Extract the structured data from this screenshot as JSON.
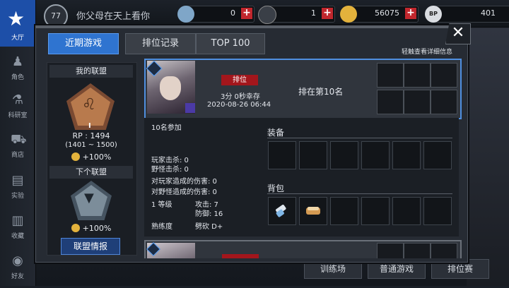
{
  "hud": {
    "level": "77",
    "username": "你父母在天上看你",
    "resource1": "0",
    "resource2": "1",
    "gold": "56075",
    "bp": "401",
    "bp_label": "BP"
  },
  "leftnav": {
    "top_label": "大厅",
    "items": [
      "角色",
      "科研室",
      "商店",
      "实验",
      "收藏",
      "好友"
    ]
  },
  "bottom_buttons": [
    "训练场",
    "普通游戏",
    "排位赛"
  ],
  "tabs": {
    "recent": "近期游戏",
    "ranked_record": "排位记录",
    "top100": "TOP 100"
  },
  "hint": "轻触查看详细信息",
  "alliance": {
    "my_title": "我的联盟",
    "rank_roman": "I",
    "rp": "RP : 1494",
    "range": "(1401 ~ 1500)",
    "bonus1": "+100%",
    "next_title": "下个联盟",
    "bonus2": "+100%",
    "info_button": "联盟情报"
  },
  "match": {
    "mode_badge": "排位",
    "survival": "3分 0秒幸存",
    "datetime": "2020-08-26 06:44",
    "rank": "排在第10名",
    "participants": "10名参加",
    "player_kills": "玩家击杀: 0",
    "monster_kills": "野怪击杀: 0",
    "dmg_player": "对玩家造成的伤害: 0",
    "dmg_monster": "对野怪造成的伤害: 0",
    "level": "1 等级",
    "attack": "攻击: 7",
    "defense": "防御: 16",
    "mastery_label": "熟练度",
    "mastery_value": "劈砍 D+",
    "equip_label": "装备",
    "bag_label": "背包"
  },
  "colors": {
    "accent_blue": "#2f74d0",
    "badge_red": "#a3161c",
    "bronze": "#b87a4d"
  }
}
